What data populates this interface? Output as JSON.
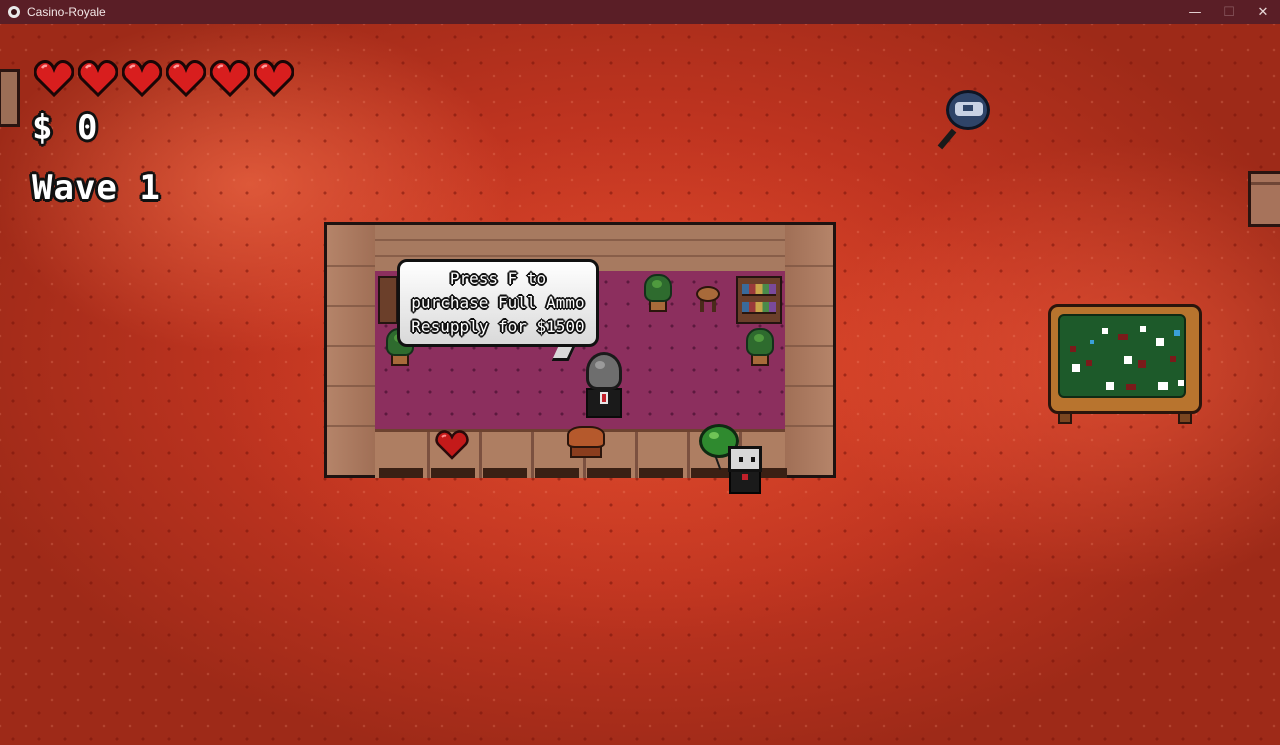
{
  "window": {
    "title": "Casino-Royale",
    "controls": {
      "minimize": "—",
      "maximize": "☐",
      "close": "✕"
    }
  },
  "hud": {
    "hearts": {
      "filled": 6,
      "max": 6,
      "icon": "heart-icon",
      "color": "#d81e1e"
    },
    "money_label": "$ 0",
    "wave_label": "Wave 1"
  },
  "shop": {
    "prompt": "Press F to\npurchase Full Ammo\nResupply for $1500",
    "items": [
      {
        "name": "heart",
        "icon": "heart-icon"
      },
      {
        "name": "ammo",
        "icon": "ammo-crate-icon"
      }
    ]
  },
  "colors": {
    "carpet": "#c23a22",
    "shop_floor": "#8c2f5e",
    "wall": "#a9785e",
    "felt": "#1d5a2a",
    "titlebar": "#5a1e26"
  }
}
